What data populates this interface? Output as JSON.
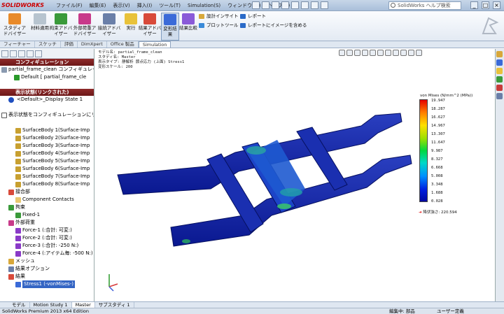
{
  "app": {
    "logo_text": "SOLIDWORKS",
    "menus": [
      "ファイル(F)",
      "編集(E)",
      "表示(V)",
      "挿入(I)",
      "ツール(T)",
      "Simulation(S)",
      "ウィンドウ(W)",
      "ヘルプ(H)"
    ],
    "search_placeholder": "SolidWorks ヘルプ検索"
  },
  "ribbon": {
    "buttons": [
      "スタディアドバイザー",
      "材料適用",
      "拘束アドバイザー",
      "外部荷重アドバイザー",
      "接続アドバイザー",
      "実行",
      "結果アドバイザー",
      "変形結果",
      "結果比較"
    ],
    "small": [
      "設計インサイト",
      "プロットツール",
      "レポート",
      "レポートにイメージを含める"
    ]
  },
  "tabs": [
    "フィーチャー",
    "スケッチ",
    "評価",
    "DimXpert",
    "Office 製品",
    "Simulation"
  ],
  "left": {
    "config_header": "コンフィギュレーション",
    "config_root": "partial_frame_clean コンフィギュレーション",
    "config_default": "Default [ partial_frame_cle",
    "display_header": "表示状態(リンクされた)",
    "display_state": "<Default>_Display State 1",
    "link_label": "表示状態をコンフィギュレーションにリンク",
    "bodies": [
      "SurfaceBody 1(Surface-Imp",
      "SurfaceBody 2(Surface-Imp",
      "SurfaceBody 3(Surface-Imp",
      "SurfaceBody 4(Surface-Imp",
      "SurfaceBody 5(Surface-Imp",
      "SurfaceBody 6(Surface-Imp",
      "SurfaceBody 7(Surface-Imp",
      "SurfaceBody 8(Surface-Imp"
    ],
    "joints": "接合部",
    "component_contacts": "Component Contacts",
    "fixtures": "拘束",
    "fixed": "Fixed-1",
    "loads": "外部荷重",
    "forces": [
      "Force-1 (:合計: 可変:)",
      "Force-2 (:合計: 可変:)",
      "Force-3 (:合計: -250 N:)",
      "Force-4 (:アイテム毎: -500 N:)"
    ],
    "mesh": "メッシュ",
    "result_options": "結果オプション",
    "results": "結果",
    "stress": "Stress1 (-vonMises-)"
  },
  "viewport": {
    "info": [
      "モデル名: partial_frame_clean",
      "スタディ名: Master",
      "表示タイプ: 静解析 節点応力 (上面) Stress1",
      "変形スケール: 200"
    ]
  },
  "legend": {
    "title": "von Mises (N/mm^2 (MPa))",
    "values": [
      "19.947",
      "18.287",
      "16.627",
      "14.967",
      "13.307",
      "11.647",
      "9.987",
      "8.327",
      "6.668",
      "5.008",
      "3.348",
      "1.688",
      "0.028"
    ],
    "yield": "降伏強さ: 220.594",
    "colors": [
      "#e60000",
      "#ffe000",
      "#00d840",
      "#0090ff",
      "#0008a0"
    ]
  },
  "bottom_tabs": [
    "モデル",
    "Motion Study 1",
    "Master",
    "サブスタディ 1"
  ],
  "status": {
    "left": "SolidWorks Premium 2013 x64 Edition",
    "mid": "編集中: 部品",
    "right": "ユーザー定義"
  }
}
